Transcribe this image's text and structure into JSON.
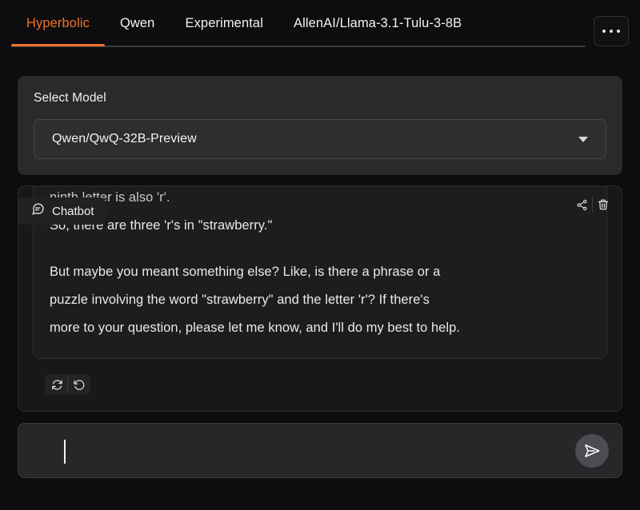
{
  "tabs": [
    {
      "label": "Hyperbolic",
      "active": true
    },
    {
      "label": "Qwen",
      "active": false
    },
    {
      "label": "Experimental",
      "active": false
    },
    {
      "label": "AllenAI/Llama-3.1-Tulu-3-8B",
      "active": false
    }
  ],
  "header": {
    "more_options_icon": "ellipsis-horizontal-icon",
    "active_tab_accent": "#ef7228"
  },
  "model_selector": {
    "label": "Select Model",
    "selected_value": "Qwen/QwQ-32B-Preview",
    "chevron_icon": "chevron-down-icon"
  },
  "chatbot": {
    "badge_label": "Chatbot",
    "badge_icon": "chat-bubble-icon",
    "tools": [
      {
        "icon": "share-nodes-icon",
        "name": "share-button"
      },
      {
        "icon": "trash-icon",
        "name": "delete-button"
      }
    ],
    "message": {
      "clipped_top_line": "ninth letter is also 'r'.",
      "lines": [
        "So, there are three 'r's in \"strawberry.\"",
        "But maybe you meant something else? Like, is there a phrase or a",
        "puzzle involving the word \"strawberry\" and the letter 'r'? If there's",
        "more to your question, please let me know, and I'll do my best to help."
      ]
    },
    "actions": [
      {
        "icon": "retry-icon",
        "name": "retry-button"
      },
      {
        "icon": "undo-icon",
        "name": "undo-button"
      }
    ]
  },
  "input_bar": {
    "value": "",
    "placeholder": "",
    "send_icon": "send-paper-plane-icon"
  },
  "colors": {
    "page_background": "#0d0d0f",
    "panel_background": "#2a2a2c",
    "chatbot_background": "#18181b",
    "bubble_background": "#1d1d20",
    "input_background": "#27272a",
    "accent_orange": "#ef7228",
    "send_button": "#4c4c53",
    "text_primary": "#e9e9e9"
  }
}
